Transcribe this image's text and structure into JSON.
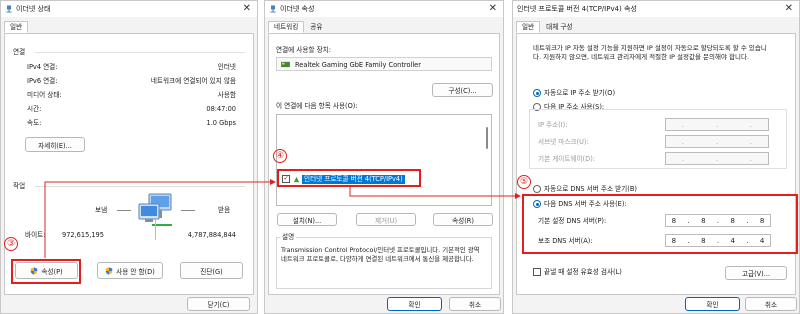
{
  "win1": {
    "title": "이더넷 상태",
    "tab": "일반",
    "section_connection": "연결",
    "rows": [
      {
        "label": "IPv4 연결:",
        "value": "인터넷"
      },
      {
        "label": "IPv6 연결:",
        "value": "네트워크에 연결되어 있지 않음"
      },
      {
        "label": "미디어 상태:",
        "value": "사용함"
      },
      {
        "label": "시간:",
        "value": "08:47:00"
      },
      {
        "label": "속도:",
        "value": "1.0 Gbps"
      }
    ],
    "details_button": "자세히(E)...",
    "section_activity": "작업",
    "sent_label": "보냄",
    "recv_label": "받음",
    "bytes_label": "바이트:",
    "bytes_sent": "972,615,195",
    "bytes_recv": "4,787,884,844",
    "properties_button": "속성(P)",
    "disable_button": "사용 안 함(D)",
    "diagnose_button": "진단(G)",
    "close_button": "닫기(C)",
    "step": "③"
  },
  "win2": {
    "title": "이더넷 속성",
    "tab_networking": "네트워킹",
    "tab_sharing": "공유",
    "connect_using_label": "연결에 사용할 장치:",
    "adapter": "Realtek Gaming GbE Family Controller",
    "configure_button": "구성(C)...",
    "items_label": "이 연결에 다음 항목 사용(O):",
    "selected_item": "인터넷 프로토콜 버전 4(TCP/IPv4)",
    "install_button": "설치(N)...",
    "uninstall_button": "제거(U)",
    "properties_button": "속성(R)",
    "description_label": "설명",
    "description": "Transmission Control Protocol/인터넷 프로토콜입니다. 기본적인 광역 네트워크 프로토콜로, 다양하게 연결된 네트워크에서 통신을 제공합니다.",
    "ok_button": "확인",
    "cancel_button": "취소",
    "step": "④"
  },
  "win3": {
    "title": "인터넷 프로토콜 버전 4(TCP/IPv4) 속성",
    "tab_general": "일반",
    "tab_alternate": "대체 구성",
    "intro": "네트워크가 IP 자동 설정 기능을 지원하면 IP 설정이 자동으로 할당되도록 할 수 있습니다. 지원하지 않으면, 네트워크 관리자에게 적절한 IP 설정값을 문의해야 합니다.",
    "auto_ip": "자동으로 IP 주소 받기(O)",
    "manual_ip": "다음 IP 주소 사용(S):",
    "ip_label": "IP 주소(I):",
    "subnet_label": "서브넷 마스크(U):",
    "gateway_label": "기본 게이트웨이(D):",
    "auto_dns": "자동으로 DNS 서버 주소 받기(B)",
    "manual_dns": "다음 DNS 서버 주소 사용(E):",
    "preferred_dns_label": "기본 설정 DNS 서버(P):",
    "alternate_dns_label": "보조 DNS 서버(A):",
    "preferred_dns": [
      "8",
      "8",
      "8",
      "8"
    ],
    "alternate_dns": [
      "8",
      "8",
      "4",
      "4"
    ],
    "validate": "끝낼 때 설정 유효성 검사(L)",
    "advanced_button": "고급(V)...",
    "ok_button": "확인",
    "cancel_button": "취소",
    "step": "⑤"
  },
  "colors": {
    "accent": "#0067c0",
    "highlight": "#e02020",
    "selection": "#0078d7"
  }
}
